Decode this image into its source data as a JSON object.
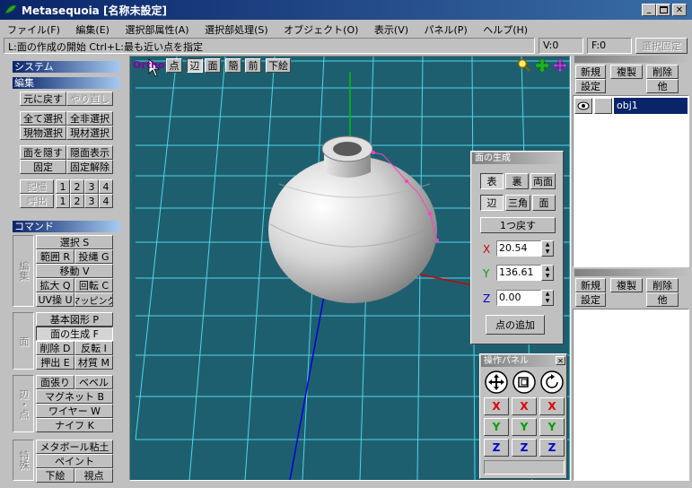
{
  "window": {
    "title": "Metasequoia [名称未設定]"
  },
  "menu": [
    "ファイル(F)",
    "編集(E)",
    "選択部属性(A)",
    "選択部処理(S)",
    "オブジェクト(O)",
    "表示(V)",
    "パネル(P)",
    "ヘルプ(H)"
  ],
  "status": {
    "hint": "L:面の作成の開始  Ctrl+L:最も近い点を指定",
    "vertices": "V:0",
    "faces": "F:0",
    "lock": "選択固定"
  },
  "view_toolbar": {
    "ortho": "Ortho",
    "point": "点",
    "edge": "辺",
    "face": "面",
    "simple": "簡",
    "front": "前",
    "underlay": "下絵"
  },
  "left_panel": {
    "system": "システム",
    "edit": "編集",
    "undo": "元に戻す",
    "redo": "やり直し",
    "select_all": "全て選択",
    "deselect_all": "全非選択",
    "select_current": "現物選択",
    "select_material": "現材選択",
    "hide_faces": "面を隠す",
    "show_hidden": "隠面表示",
    "fix": "固定",
    "unfix": "固定解除",
    "memory": "記憶",
    "recall": "呼出",
    "mem_nums": [
      "1",
      "2",
      "3",
      "4"
    ],
    "command": "コマンド",
    "edit_group": "編集",
    "select": "選択 S",
    "range": "範囲 R",
    "lasso": "投縄 G",
    "move": "移動 V",
    "scale": "拡大 Q",
    "rotate": "回転 C",
    "uv": "UV操 U",
    "mapping": "マッピング",
    "face_group": "面",
    "primitive": "基本図形 P",
    "face_gen": "面の生成 F",
    "delete": "削除 D",
    "flip": "反転 I",
    "extrude": "押出 E",
    "material": "材質 M",
    "vertex_group": "辺・点",
    "face_stretch": "面張り",
    "bevel": "ベベル",
    "magnet": "マグネット B",
    "wire": "ワイヤー W",
    "knife": "ナイフ K",
    "special_group": "特殊",
    "metaball": "メタボール粘土",
    "paint": "ペイント",
    "underlay": "下絵",
    "viewpoint": "視点"
  },
  "face_panel": {
    "title": "面の生成",
    "front": "表",
    "back": "裏",
    "both": "両面",
    "edge": "辺",
    "triangle": "三角",
    "face": "面",
    "undo_one": "1つ戻す",
    "x_label": "X",
    "x_value": "20.54",
    "y_label": "Y",
    "y_value": "136.61",
    "z_label": "Z",
    "z_value": "0.00",
    "add_point": "点の追加"
  },
  "ops_panel": {
    "title": "操作パネル",
    "x": "X",
    "y": "Y",
    "z": "Z"
  },
  "object_panel": {
    "new": "新規",
    "copy": "複製",
    "delete": "削除",
    "settings": "設定",
    "other": "他",
    "object_name": "obj1"
  },
  "material_panel": {
    "new": "新規",
    "copy": "複製",
    "delete": "削除",
    "settings": "設定",
    "other": "他"
  },
  "colors": {
    "title_bar": "#0a246a",
    "viewport_bg": "#1e5f6f",
    "grid": "#4fd6e8",
    "x_axis": "#d00000",
    "y_axis": "#00c000",
    "z_axis": "#0000e0"
  }
}
